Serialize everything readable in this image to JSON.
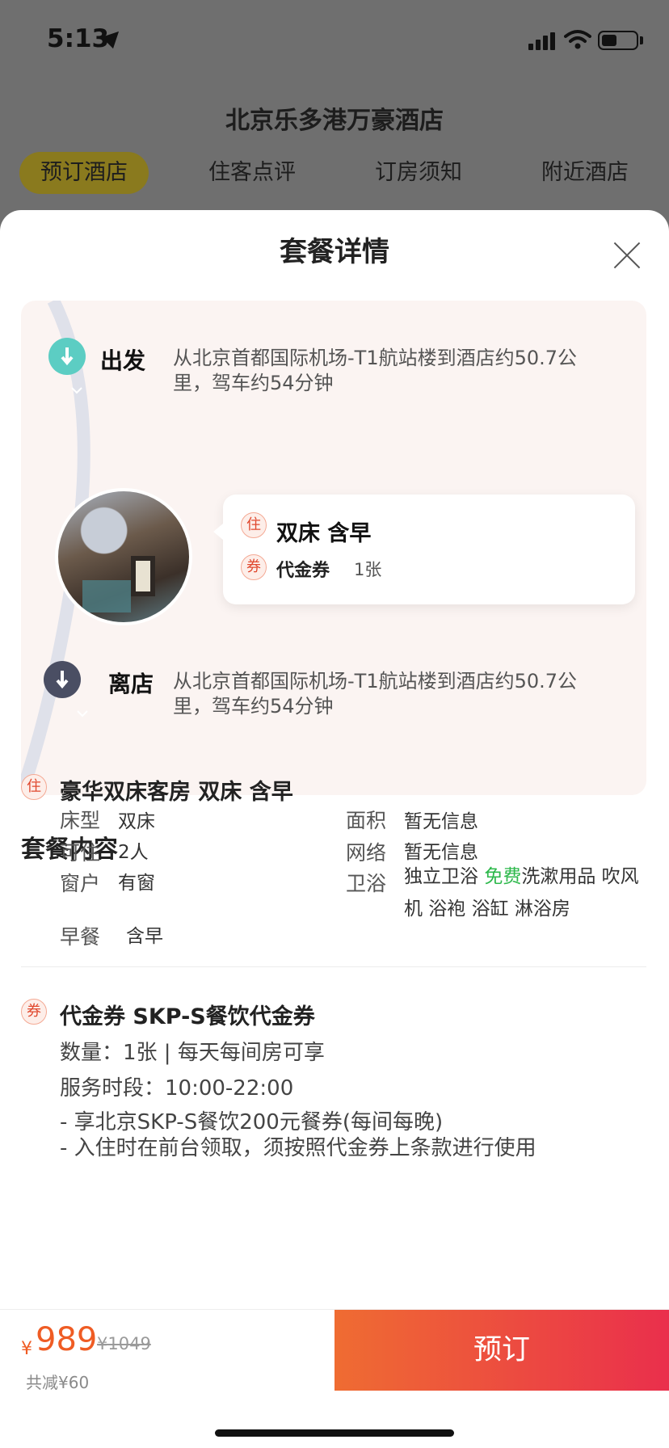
{
  "status_bar": {
    "time": "5:13"
  },
  "header": {
    "hotel_name": "北京乐多港万豪酒店",
    "tabs": [
      {
        "label": "预订酒店",
        "active": true
      },
      {
        "label": "住客点评",
        "active": false
      },
      {
        "label": "订房须知",
        "active": false
      },
      {
        "label": "附近酒店",
        "active": false
      }
    ]
  },
  "sheet": {
    "title": "套餐详情",
    "route": {
      "depart": {
        "label": "出发",
        "desc": "从北京首都国际机场-T1航站楼到酒店约50.7公里，驾车约54分钟"
      },
      "arrive": {
        "label": "离店",
        "desc": "从北京首都国际机场-T1航站楼到酒店约50.7公里，驾车约54分钟"
      },
      "card": {
        "stay_tag": "住",
        "stay_text": "双床  含早",
        "coupon_tag": "券",
        "coupon_label": "代金券",
        "coupon_count": "1张"
      }
    },
    "content": {
      "title": "套餐内容",
      "room": {
        "tag": "住",
        "title": "豪华双床客房 双床  含早",
        "bed_k": "床型",
        "bed_v": "双床",
        "occ_k": "可住",
        "occ_v": "2人",
        "window_k": "窗户",
        "window_v": "有窗",
        "area_k": "面积",
        "area_v": "暂无信息",
        "net_k": "网络",
        "net_v": "暂无信息",
        "bath_k": "卫浴",
        "bath_v1": "独立卫浴 ",
        "bath_free": "免费",
        "bath_v2": "洗漱用品 吹风机 浴袍 浴缸 淋浴房",
        "breakfast_k": "早餐",
        "breakfast_v": "含早"
      },
      "coupon": {
        "tag": "券",
        "title": "代金券  SKP-S餐饮代金券",
        "qty": "数量：1张 | 每天每间房可享",
        "hours": "服务时段：10:00-22:00",
        "note1": "- 享北京SKP-S餐饮200元餐券(每间每晚)",
        "note2": "- 入住时在前台领取，须按照代金券上条款进行使用"
      }
    }
  },
  "footer": {
    "currency": "¥",
    "price": "989",
    "old_price": "¥1049",
    "saved": "共减¥60",
    "book_label": "预订"
  },
  "colors": {
    "accent": "#ef5c24",
    "button_start": "#ef6c32",
    "button_end": "#ea2f4c",
    "tab_active": "#8a7a1e"
  }
}
